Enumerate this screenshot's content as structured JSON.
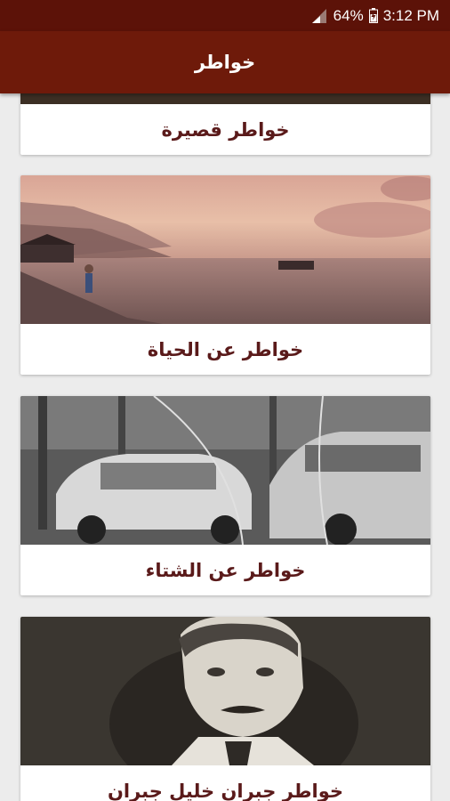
{
  "status_bar": {
    "battery_percent": "64%",
    "time": "3:12 PM",
    "signal_icon": "signal-icon",
    "battery_icon": "battery-charging-icon"
  },
  "app_bar": {
    "title": "خواطر"
  },
  "cards": [
    {
      "title": "خواطر قصيرة",
      "image": "sepia-photo"
    },
    {
      "title": "خواطر عن الحياة",
      "image": "sunset-pier-photo"
    },
    {
      "title": "خواطر عن الشتاء",
      "image": "rainy-window-cars-photo"
    },
    {
      "title": "خواطر جبران خليل جبران",
      "image": "portrait-photo"
    }
  ],
  "colors": {
    "status_bar": "#5c1208",
    "app_bar": "#6e1a0a",
    "caption_text": "#5a1a1a",
    "background": "#ececec"
  }
}
